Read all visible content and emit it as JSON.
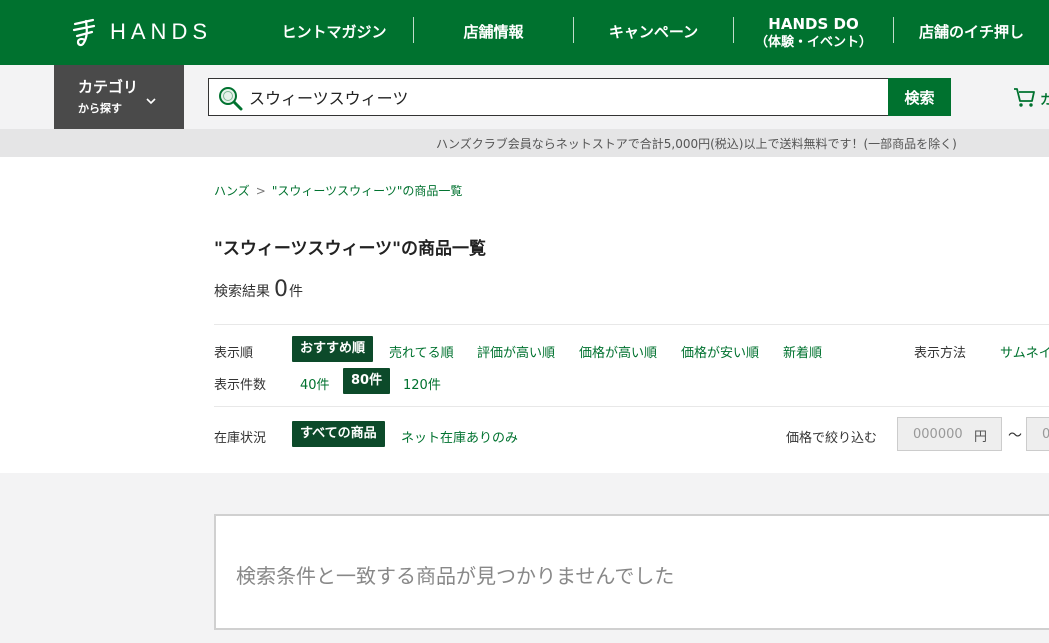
{
  "header": {
    "logo_text": "HANDS",
    "nav": [
      {
        "label": "ヒントマガジン"
      },
      {
        "label": "店舗情報"
      },
      {
        "label": "キャンペーン"
      },
      {
        "label": "HANDS DO",
        "sub": "（体験・イベント）"
      },
      {
        "label": "店舗のイチ押し"
      }
    ]
  },
  "category": {
    "line1": "カテゴリ",
    "line2": "から探す"
  },
  "search": {
    "value": "スウィーツスウィーツ",
    "button_label": "検索"
  },
  "cart": {
    "label": "カ"
  },
  "notice": "ハンズクラブ会員ならネットストアで合計5,000円(税込)以上で送料無料です！(一部商品を除く)",
  "breadcrumb": {
    "home": "ハンズ",
    "separator": ">",
    "current": "\"スウィーツスウィーツ\"の商品一覧"
  },
  "page_title": "\"スウィーツスウィーツ\"の商品一覧",
  "result": {
    "label": "検索結果",
    "count": "0",
    "unit": "件"
  },
  "sort": {
    "label": "表示順",
    "options": [
      "おすすめ順",
      "売れてる順",
      "評価が高い順",
      "価格が高い順",
      "価格が安い順",
      "新着順"
    ],
    "active_index": 0
  },
  "display_method": {
    "label": "表示方法",
    "option": "サムネイ"
  },
  "per_page": {
    "label": "表示件数",
    "options": [
      "40件",
      "80件",
      "120件"
    ],
    "active_index": 1
  },
  "stock": {
    "label": "在庫状況",
    "options": [
      "すべての商品",
      "ネット在庫ありのみ"
    ],
    "active_index": 0
  },
  "price_filter": {
    "label": "価格で絞り込む",
    "min_placeholder": "000000",
    "unit": "円",
    "tilde": "〜",
    "max_placeholder": "0"
  },
  "empty_message": "検索条件と一致する商品が見つかりませんでした",
  "colors": {
    "brand_green": "#00722f",
    "active_dark": "#0c4a2a",
    "category_bg": "#4a4a4a"
  }
}
